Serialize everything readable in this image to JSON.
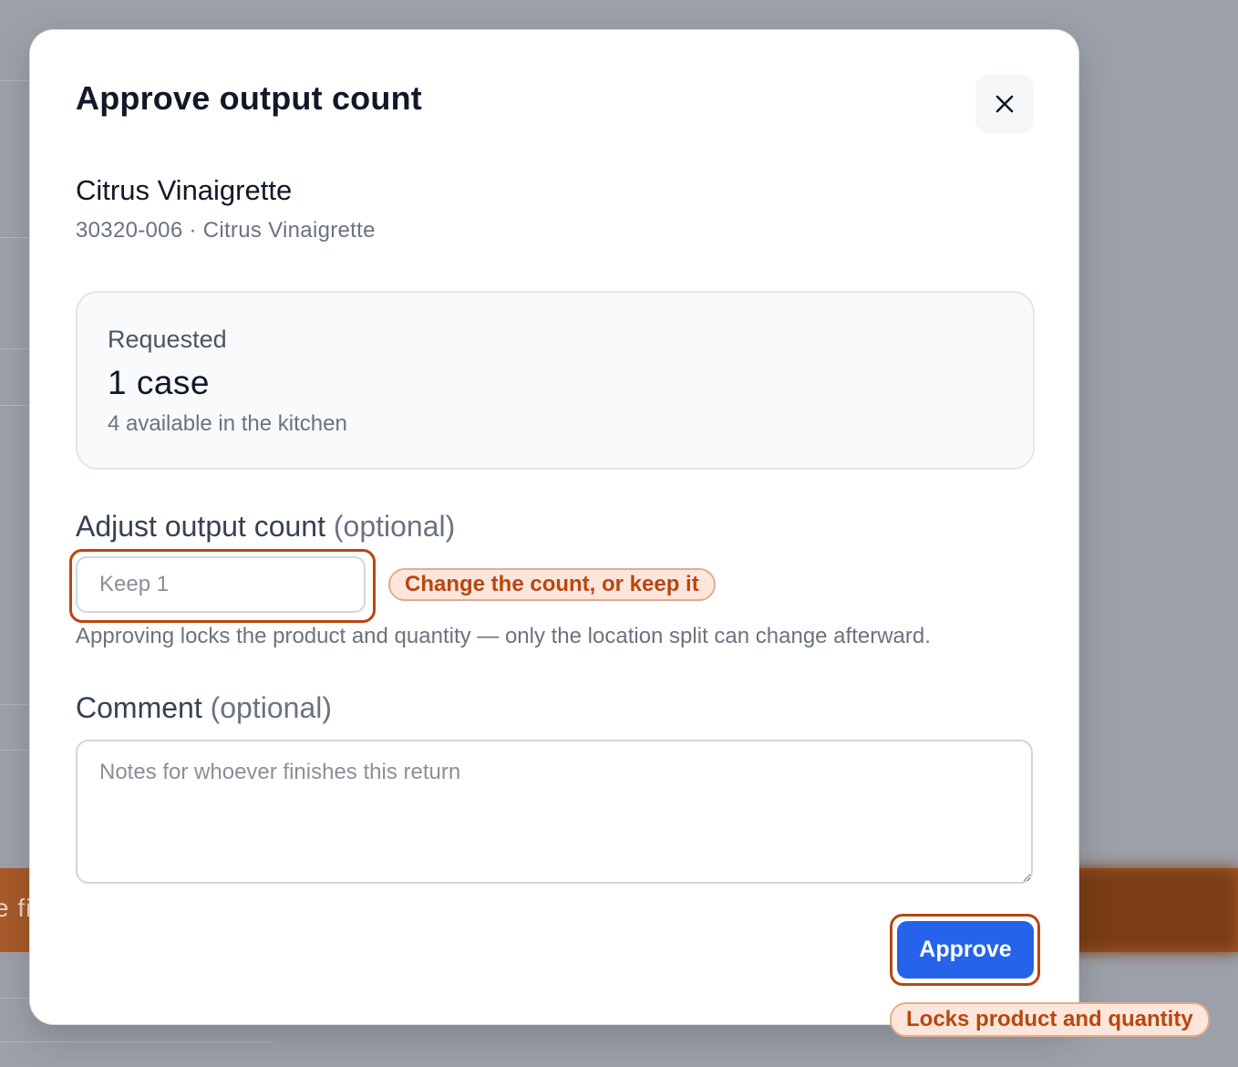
{
  "modal": {
    "title": "Approve output count",
    "close_icon": "close-icon"
  },
  "product": {
    "name": "Citrus Vinaigrette",
    "sku_line": "30320-006 · Citrus Vinaigrette"
  },
  "requested": {
    "label": "Requested",
    "value": "1 case",
    "availability": "4 available in the kitchen"
  },
  "adjust": {
    "label": "Adjust output count",
    "optional": "(optional)",
    "placeholder": "Keep 1",
    "hint_pill": "Change the count, or keep it",
    "help": "Approving locks the product and quantity — only the location split can change afterward."
  },
  "comment": {
    "label": "Comment",
    "optional": "(optional)",
    "placeholder": "Notes for whoever finishes this return"
  },
  "actions": {
    "approve_label": "Approve",
    "approve_pill": "Locks product and quantity"
  },
  "background": {
    "banner_text": "e fi"
  },
  "colors": {
    "primary": "#2563eb",
    "highlight": "#b8470f",
    "pill_bg": "#fce6db",
    "overlay": "#9ca0a8"
  }
}
